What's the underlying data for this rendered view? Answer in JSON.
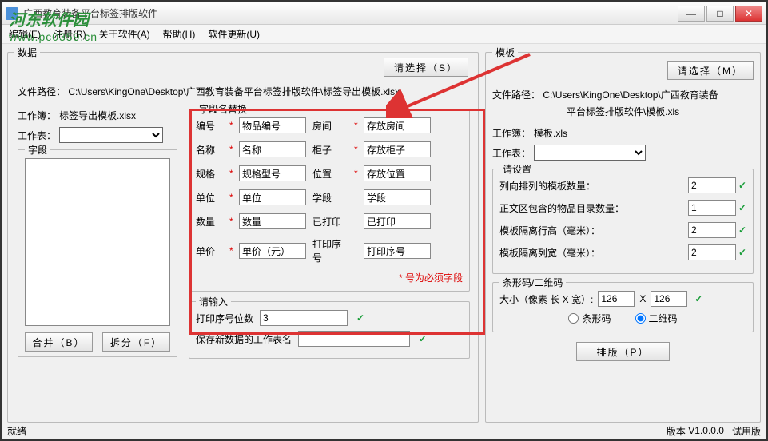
{
  "window": {
    "title": "广西教育装备平台标签排版软件"
  },
  "menu": {
    "edit": "编辑(E)",
    "register": "注册(R)",
    "about": "关于软件(A)",
    "help": "帮助(H)",
    "update": "软件更新(U)"
  },
  "watermark": {
    "logo": "河东软件园",
    "url": "www.pc0359.cn"
  },
  "data": {
    "title": "数据",
    "select_btn": "请选择（S）",
    "file_path_label": "文件路径：",
    "file_path": "C:\\Users\\KingOne\\Desktop\\广西教育装备平台标签排版软件\\标签导出模板.xlsx",
    "workbook_label": "工作簿：",
    "workbook": "标签导出模板.xlsx",
    "worksheet_label": "工作表：",
    "worksheet": "",
    "fields_title": "字段",
    "merge_btn": "合并（B）",
    "split_btn": "拆分（F）"
  },
  "replace": {
    "title": "字段名替换",
    "rows": [
      {
        "l": "编号",
        "lv": "物品编号",
        "r": "房间",
        "rv": "存放房间",
        "ls": true,
        "rs": true
      },
      {
        "l": "名称",
        "lv": "名称",
        "r": "柜子",
        "rv": "存放柜子",
        "ls": true,
        "rs": true
      },
      {
        "l": "规格",
        "lv": "规格型号",
        "r": "位置",
        "rv": "存放位置",
        "ls": true,
        "rs": true
      },
      {
        "l": "单位",
        "lv": "单位",
        "r": "学段",
        "rv": "学段",
        "ls": true,
        "rs": false
      },
      {
        "l": "数量",
        "lv": "数量",
        "r": "已打印",
        "rv": "已打印",
        "ls": true,
        "rs": false
      },
      {
        "l": "单价",
        "lv": "单价（元）",
        "r": "打印序号",
        "rv": "打印序号",
        "ls": true,
        "rs": false
      }
    ],
    "note": "* 号为必须字段"
  },
  "enter": {
    "title": "请输入",
    "print_seq_digits_label": "打印序号位数",
    "print_seq_digits": "3",
    "save_sheet_label": "保存新数据的工作表名",
    "save_sheet": ""
  },
  "template": {
    "title": "模板",
    "select_btn": "请选择（M）",
    "file_path_label": "文件路径：",
    "file_path_line1": "C:\\Users\\KingOne\\Desktop\\广西教育装备",
    "file_path_line2": "平台标签排版软件\\模板.xls",
    "workbook_label": "工作簿：",
    "workbook": "模板.xls",
    "worksheet_label": "工作表：",
    "worksheet": ""
  },
  "settings": {
    "title": "请设置",
    "cols_label": "列向排列的模板数量：",
    "cols": "2",
    "rows_label": "正文区包含的物品目录数量：",
    "rows": "1",
    "row_gap_label": "模板隔离行高（毫米）：",
    "row_gap": "2",
    "col_gap_label": "模板隔离列宽（毫米）：",
    "col_gap": "2"
  },
  "barcode": {
    "title": "条形码/二维码",
    "size_label": "大小（像素 长 X 宽）:",
    "w": "126",
    "x": "X",
    "h": "126",
    "bar_label": "条形码",
    "qr_label": "二维码",
    "selected": "qr"
  },
  "layout_btn": "排版（P）",
  "status": {
    "ready": "就绪",
    "version_label": "版本",
    "version": "V1.0.0.0",
    "trial": "试用版"
  }
}
